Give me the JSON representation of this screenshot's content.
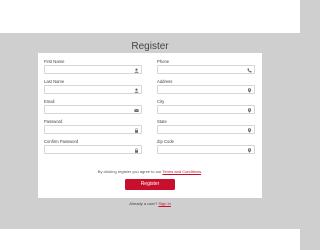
{
  "page": {
    "title": "Register"
  },
  "form": {
    "left_fields": [
      {
        "label": "First Name",
        "icon": "user-icon"
      },
      {
        "label": "Last Name",
        "icon": "user-icon"
      },
      {
        "label": "Email",
        "icon": "email-icon"
      },
      {
        "label": "Password",
        "icon": "lock-icon"
      },
      {
        "label": "Confirm Password",
        "icon": "lock-icon"
      }
    ],
    "right_fields": [
      {
        "label": "Phone",
        "icon": "phone-icon"
      },
      {
        "label": "Address",
        "icon": "location-pin-icon"
      },
      {
        "label": "City",
        "icon": "location-pin-icon"
      },
      {
        "label": "State",
        "icon": "location-pin-icon"
      },
      {
        "label": "Zip Code",
        "icon": "location-pin-icon"
      }
    ],
    "terms_prefix": "By clicking register you agree to our ",
    "terms_link": "Terms and Conditions",
    "terms_suffix": ".",
    "submit_label": "Register"
  },
  "footer": {
    "prompt": "Already a user? ",
    "link": "Sign In"
  },
  "colors": {
    "accent": "#c8102e",
    "background": "#cfcfcf",
    "card": "#ffffff"
  }
}
